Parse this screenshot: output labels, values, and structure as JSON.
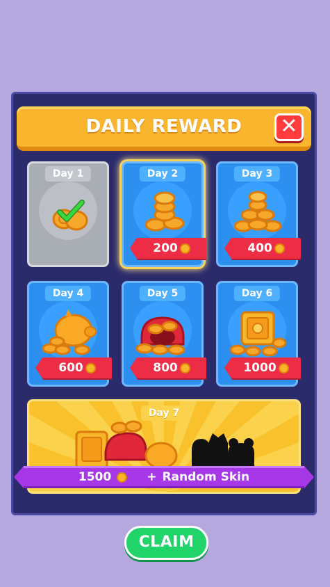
{
  "header": {
    "title": "DAILY REWARD",
    "close_icon": "close-icon"
  },
  "days": [
    {
      "label": "Day 1",
      "amount": "",
      "state": "claimed"
    },
    {
      "label": "Day 2",
      "amount": "200",
      "state": "today"
    },
    {
      "label": "Day 3",
      "amount": "400",
      "state": "locked"
    },
    {
      "label": "Day 4",
      "amount": "600",
      "state": "locked"
    },
    {
      "label": "Day 5",
      "amount": "800",
      "state": "locked"
    },
    {
      "label": "Day 6",
      "amount": "1000",
      "state": "locked"
    }
  ],
  "day7": {
    "label": "Day 7",
    "amount": "1500",
    "plus": "+",
    "bonus": "Random Skin"
  },
  "claim_button": "CLAIM",
  "colors": {
    "background": "#b4a8de",
    "panel": "#2b2a6b",
    "header": "#f9b52d",
    "card": "#2d8ff0",
    "ribbon": "#ec2d45",
    "banner": "#a638e8",
    "claim": "#21d46a"
  }
}
